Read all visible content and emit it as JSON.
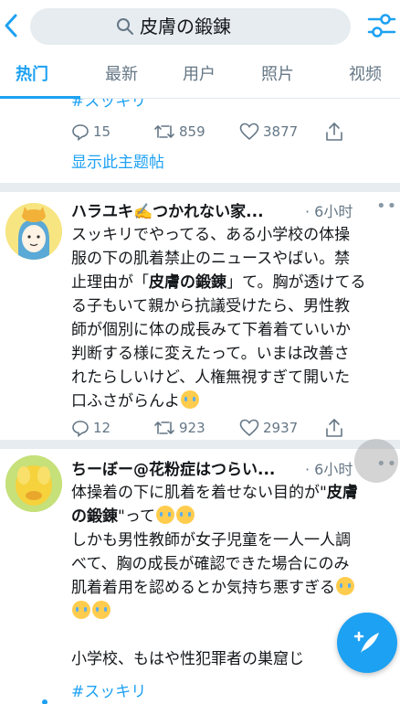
{
  "header": {
    "search_query": "皮膚の鍛錬",
    "back_icon": "chevron-left-icon",
    "filter_icon": "sliders-icon"
  },
  "tabs": [
    {
      "label": "热门",
      "active": true
    },
    {
      "label": "最新",
      "active": false
    },
    {
      "label": "用户",
      "active": false
    },
    {
      "label": "照片",
      "active": false
    },
    {
      "label": "视频",
      "active": false
    }
  ],
  "previous_tweet": {
    "hashtag": "#スッキリ",
    "replies": "15",
    "retweets": "859",
    "likes": "3877",
    "show_thread": "显示此主题帖"
  },
  "tweets": [
    {
      "name": "ハラユキ✍️つかれない家...",
      "time": "· 6小时",
      "lines": [
        "スッキリでやってる、ある小学校の体操",
        "服の下の肌着禁止のニュースやばい。禁",
        "止理由が「",
        "皮膚の鍛錬",
        "」て。胸が透けてる",
        "る子もいて親から抗議受けたら、男性教",
        "師が個別に体の成長みて下着着ていいか",
        "判断する様に変えたって。いまは改善さ",
        "れたらしいけど、人権無視すぎて開いた",
        "口ふさがらんよ"
      ],
      "replies": "12",
      "retweets": "923",
      "likes": "2937"
    },
    {
      "name": "ちーぼー@花粉症はつらい...",
      "time": "· 6小时",
      "lines": [
        "体操着の下に肌着を着せない目的が\"",
        "皮膚",
        "の鍛錬",
        "\"って",
        "しかも男性教師が女子児童を一人一人調",
        "べて、胸の成長が確認できた場合にのみ",
        "肌着着用を認めるとか気持ち悪すぎる",
        "",
        "小学校、もはや性犯罪者の巣窟じ",
        "#スッキリ"
      ]
    }
  ],
  "colors": {
    "accent": "#1da1f2",
    "muted": "#657786",
    "separator": "#e6ecf0"
  }
}
